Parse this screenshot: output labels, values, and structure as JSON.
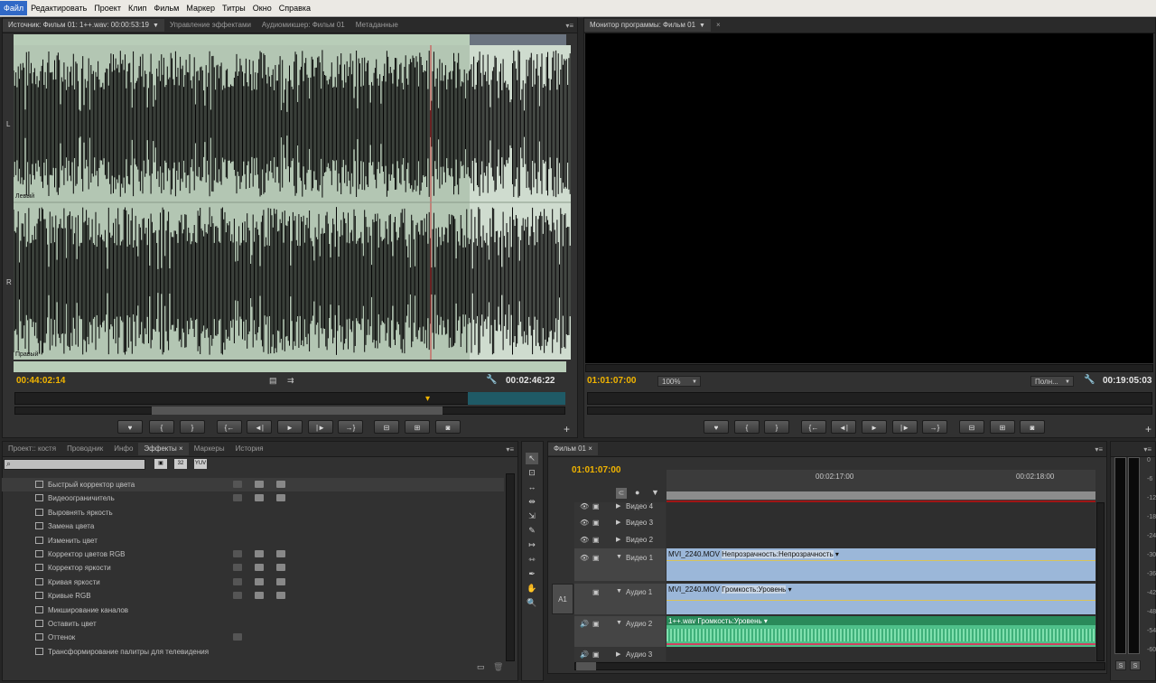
{
  "menu": [
    "Файл",
    "Редактировать",
    "Проект",
    "Клип",
    "Фильм",
    "Маркер",
    "Титры",
    "Окно",
    "Справка"
  ],
  "source_panel": {
    "tabs": [
      "Источник: Фильм 01: 1++.wav: 00:00:53:19",
      "Управление эффектами",
      "Аудиомикшер: Фильм 01",
      "Метаданные"
    ],
    "channel_left": "L",
    "channel_right": "R",
    "left_label": "Левый",
    "right_label": "Правый",
    "timecode_current": "00:44:02:14",
    "timecode_duration": "00:02:46:22"
  },
  "program_panel": {
    "tab": "Монитор программы: Фильм 01",
    "timecode_current": "01:01:07:00",
    "zoom": "100%",
    "quality": "Полн...",
    "timecode_duration": "00:19:05:03"
  },
  "controls": {
    "marker": "♥",
    "in": "{",
    "out": "}",
    "goto_in": "{←",
    "step_back": "◄|",
    "play": "►",
    "step_fwd": "|►",
    "goto_out": "→}",
    "insert": "⊟",
    "overlay": "⊞",
    "export": "◙"
  },
  "project_panel": {
    "tabs": [
      "Проект:: костя",
      "Проводник",
      "Инфо",
      "Эффекты",
      "Маркеры",
      "История"
    ],
    "search_placeholder": "",
    "filter_icons": [
      "32",
      "32",
      "YUV"
    ],
    "effects": [
      {
        "name": "Быстрый корректор цвета",
        "badges": [
          1,
          1,
          1
        ]
      },
      {
        "name": "Видеоограничитель",
        "badges": [
          1,
          1,
          1
        ]
      },
      {
        "name": "Выровнять яркость",
        "badges": [
          0,
          0,
          0
        ]
      },
      {
        "name": "Замена цвета",
        "badges": [
          0,
          0,
          0
        ]
      },
      {
        "name": "Изменить цвет",
        "badges": [
          0,
          0,
          0
        ]
      },
      {
        "name": "Корректор цветов RGB",
        "badges": [
          1,
          1,
          1
        ]
      },
      {
        "name": "Корректор яркости",
        "badges": [
          1,
          1,
          1
        ]
      },
      {
        "name": "Кривая яркости",
        "badges": [
          1,
          1,
          1
        ]
      },
      {
        "name": "Кривые RGB",
        "badges": [
          1,
          1,
          1
        ]
      },
      {
        "name": "Микширование каналов",
        "badges": [
          0,
          0,
          0
        ]
      },
      {
        "name": "Оставить цвет",
        "badges": [
          0,
          0,
          0
        ]
      },
      {
        "name": "Оттенок",
        "badges": [
          1,
          0,
          0
        ]
      },
      {
        "name": "Трансформирование палитры для телевидения",
        "badges": [
          0,
          0,
          0
        ]
      }
    ]
  },
  "timeline": {
    "tab": "Фильм 01",
    "timecode": "01:01:07:00",
    "ruler": [
      "00:02:17:00",
      "00:02:18:00"
    ],
    "target": "A1",
    "tracks": [
      {
        "name": "Видео 4"
      },
      {
        "name": "Видео 3"
      },
      {
        "name": "Видео 2"
      },
      {
        "name": "Видео 1",
        "clip": "MVI_2240.MOV",
        "fx": "Непрозрачность:Непрозрачность"
      },
      {
        "name": "Аудио 1",
        "clip": "MVI_2240.MOV",
        "fx": "Громкость:Уровень"
      },
      {
        "name": "Аудио 2",
        "clip": "1++.wav",
        "fx": "Громкость:Уровень"
      },
      {
        "name": "Аудио 3"
      }
    ]
  },
  "vu": {
    "ticks": [
      "0",
      "-6",
      "-12",
      "-18",
      "-24",
      "-30",
      "-36",
      "-42",
      "-48",
      "-54",
      "-60"
    ],
    "solo": "S"
  }
}
